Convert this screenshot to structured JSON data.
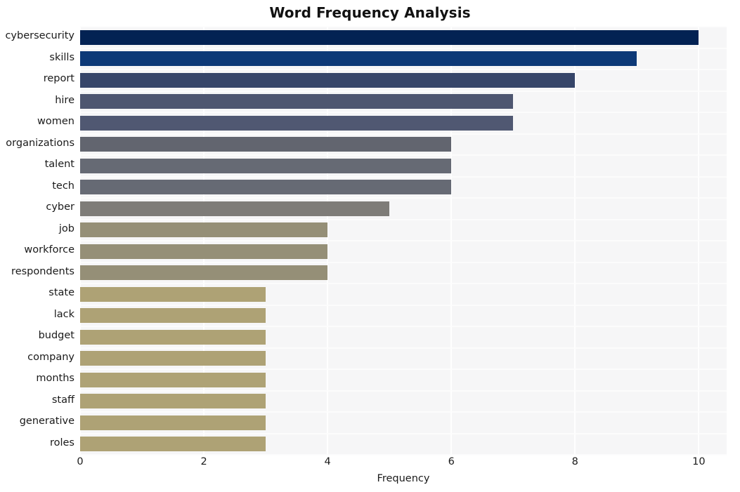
{
  "chart_data": {
    "type": "bar",
    "orientation": "horizontal",
    "title": "Word Frequency Analysis",
    "xlabel": "Frequency",
    "ylabel": "",
    "categories": [
      "cybersecurity",
      "skills",
      "report",
      "hire",
      "women",
      "organizations",
      "talent",
      "tech",
      "cyber",
      "job",
      "workforce",
      "respondents",
      "state",
      "lack",
      "budget",
      "company",
      "months",
      "staff",
      "generative",
      "roles"
    ],
    "values": [
      10,
      9,
      8,
      7,
      7,
      6,
      6,
      6,
      5,
      4,
      4,
      4,
      3,
      3,
      3,
      3,
      3,
      3,
      3,
      3
    ],
    "bar_colors": [
      "#032253",
      "#0d3977",
      "#364569",
      "#4e5670",
      "#505872",
      "#62656f",
      "#666a74",
      "#666a74",
      "#7e7c78",
      "#958f77",
      "#958f77",
      "#958f77",
      "#aea275",
      "#aea275",
      "#aea275",
      "#aea275",
      "#aea275",
      "#aea275",
      "#aea275",
      "#aea275"
    ],
    "xticks": [
      "0",
      "2",
      "4",
      "6",
      "8",
      "10"
    ],
    "xtick_values": [
      0,
      2,
      4,
      6,
      8,
      10
    ],
    "xlim": [
      0,
      10.45
    ],
    "grid": true,
    "grid_color": "#ffffff",
    "plot_background": "#f6f6f7",
    "figure_background": "#ffffff",
    "legend": null
  }
}
